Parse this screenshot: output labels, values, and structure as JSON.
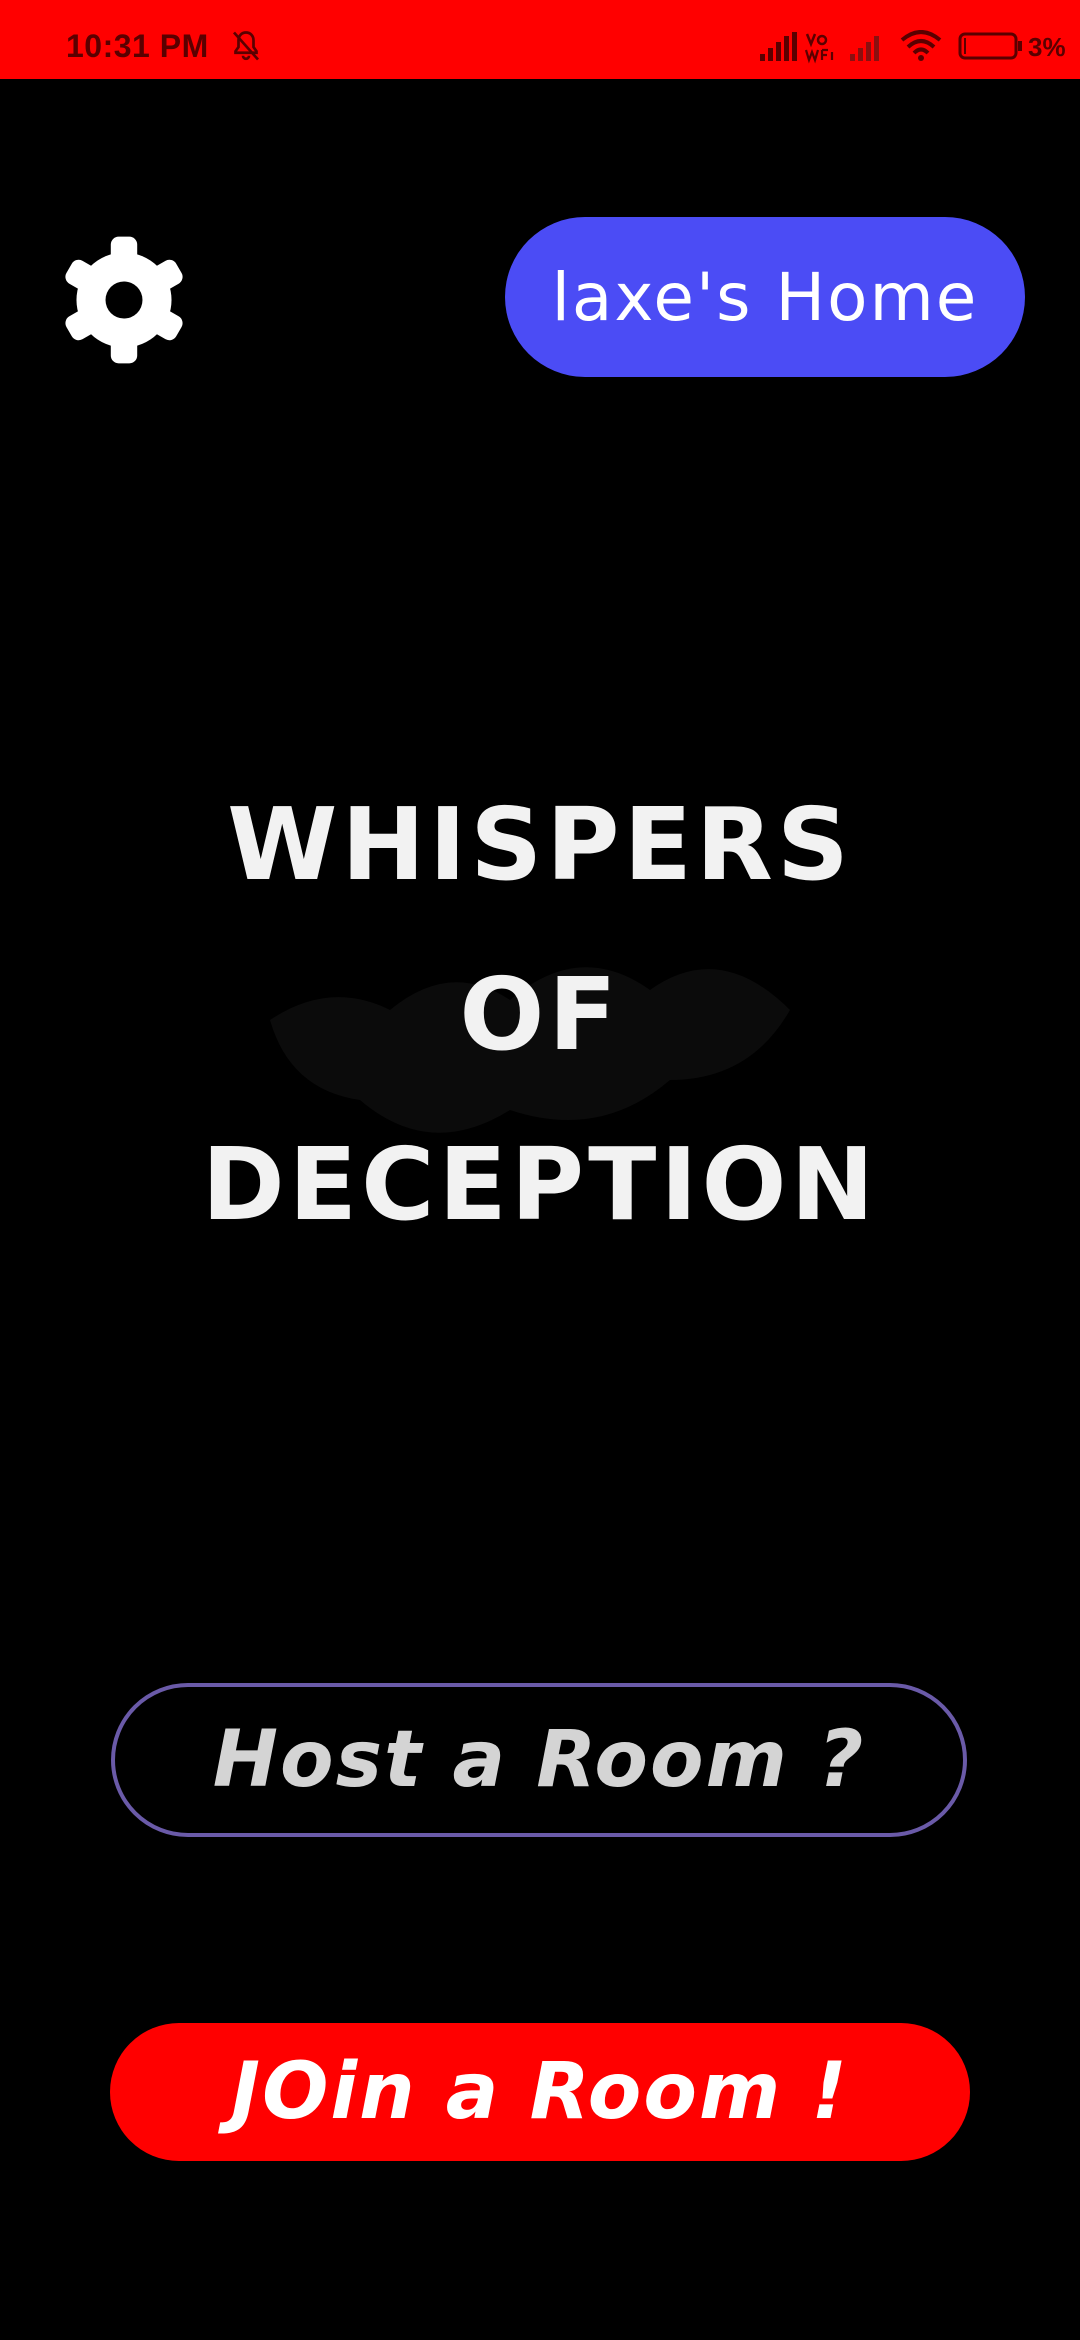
{
  "status_bar": {
    "time": "10:31 PM",
    "battery_percent": "3%",
    "background_color": "#ff0000",
    "icons": [
      "notifications-muted-icon",
      "cell-signal-icon",
      "vowifi-icon",
      "cell-signal-icon",
      "wifi-icon",
      "battery-icon"
    ]
  },
  "header": {
    "settings_icon": "gear-icon",
    "home_label": "laxe's  Home",
    "home_color": "#4b4cf5"
  },
  "title": {
    "line1": "WHISPERS",
    "line2": "OF",
    "line3": "DECEPTION"
  },
  "actions": {
    "host_label": "Host a Room ?",
    "join_label": "JOin a Room !",
    "host_border_color": "#6a5aa8",
    "join_color": "#ff0000"
  }
}
